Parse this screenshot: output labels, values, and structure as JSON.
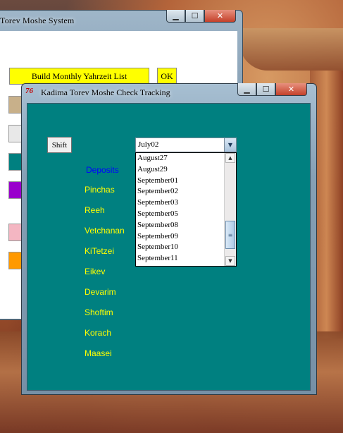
{
  "back_window": {
    "title": "Torev Moshe System",
    "build_button": "Build Monthly Yahrzeit List",
    "ok_button": "OK",
    "swatches": [
      "#c8b08a",
      "#e0e0e0",
      "#008080",
      "#9900cc",
      "#f4b6c2",
      "#ff9900"
    ]
  },
  "front_window": {
    "title": "Kadima Torev Moshe Check Tracking",
    "icon_text": "76",
    "shift_button": "Shift",
    "deposits_label": "Deposits",
    "parshiot": [
      "Pinchas",
      "Reeh",
      "Vetchanan",
      "KiTetzei",
      "Eikev",
      "Devarim",
      "Shoftim",
      "Korach",
      "Maasei"
    ],
    "combo": {
      "selected": "July02",
      "options_visible": [
        "August27",
        "August29",
        "September01",
        "September02",
        "September03",
        "September05",
        "September08",
        "September09",
        "September10",
        "September11"
      ]
    }
  },
  "caption": {
    "min": "▁",
    "max": "☐",
    "close": "✕"
  },
  "colors": {
    "client_bg": "#008080",
    "parsha_text": "#ffff00",
    "deposits_text": "#0000ff"
  }
}
